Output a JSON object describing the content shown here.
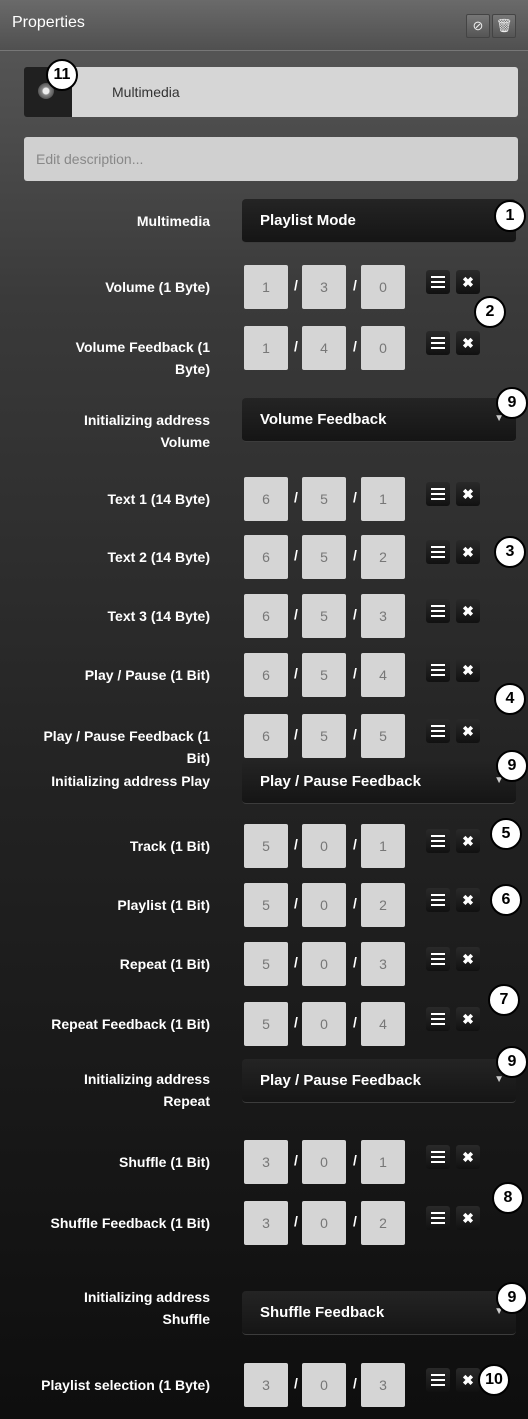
{
  "header": {
    "title": "Properties"
  },
  "object": {
    "name": "Multimedia"
  },
  "description": {
    "placeholder": "Edit description..."
  },
  "fields": {
    "multimedia": {
      "label": "Multimedia",
      "value": "Playlist Mode"
    },
    "volume": {
      "label": "Volume (1 Byte)",
      "address": [
        "1",
        "3",
        "0"
      ]
    },
    "volume_feedback": {
      "label_1": "Volume Feedback (1",
      "label_2": "Byte)",
      "address": [
        "1",
        "4",
        "0"
      ]
    },
    "init_volume": {
      "label_1": "Initializing address",
      "label_2": "Volume",
      "value": "Volume Feedback"
    },
    "text1": {
      "label": "Text 1 (14 Byte)",
      "address": [
        "6",
        "5",
        "1"
      ]
    },
    "text2": {
      "label": "Text 2 (14 Byte)",
      "address": [
        "6",
        "5",
        "2"
      ]
    },
    "text3": {
      "label": "Text 3 (14 Byte)",
      "address": [
        "6",
        "5",
        "3"
      ]
    },
    "play_pause": {
      "label": "Play / Pause (1 Bit)",
      "address": [
        "6",
        "5",
        "4"
      ]
    },
    "play_pause_feedback": {
      "label_1": "Play / Pause Feedback (1",
      "label_2": "Bit)",
      "address": [
        "6",
        "5",
        "5"
      ]
    },
    "init_play": {
      "label": "Initializing address Play",
      "value": "Play / Pause Feedback"
    },
    "track": {
      "label": "Track (1 Bit)",
      "address": [
        "5",
        "0",
        "1"
      ]
    },
    "playlist": {
      "label": "Playlist (1 Bit)",
      "address": [
        "5",
        "0",
        "2"
      ]
    },
    "repeat": {
      "label": "Repeat (1 Bit)",
      "address": [
        "5",
        "0",
        "3"
      ]
    },
    "repeat_feedback": {
      "label": "Repeat Feedback (1 Bit)",
      "address": [
        "5",
        "0",
        "4"
      ]
    },
    "init_repeat": {
      "label_1": "Initializing address",
      "label_2": "Repeat",
      "value": "Play / Pause Feedback"
    },
    "shuffle": {
      "label": "Shuffle (1 Bit)",
      "address": [
        "3",
        "0",
        "1"
      ]
    },
    "shuffle_feedback": {
      "label": "Shuffle Feedback (1 Bit)",
      "address": [
        "3",
        "0",
        "2"
      ]
    },
    "init_shuffle": {
      "label_1": "Initializing address",
      "label_2": "Shuffle",
      "value": "Shuffle Feedback"
    },
    "playlist_selection": {
      "label": "Playlist selection (1 Byte)",
      "address": [
        "3",
        "0",
        "3"
      ]
    }
  },
  "annotations": [
    "1",
    "2",
    "3",
    "4",
    "5",
    "6",
    "7",
    "8",
    "9",
    "10",
    "11"
  ],
  "icons": {
    "header_buttons": [
      "circle-slash-icon",
      "trash-icon"
    ],
    "row_buttons": [
      "list-icon",
      "close-icon"
    ],
    "dropdown": "triangle-down-icon"
  }
}
